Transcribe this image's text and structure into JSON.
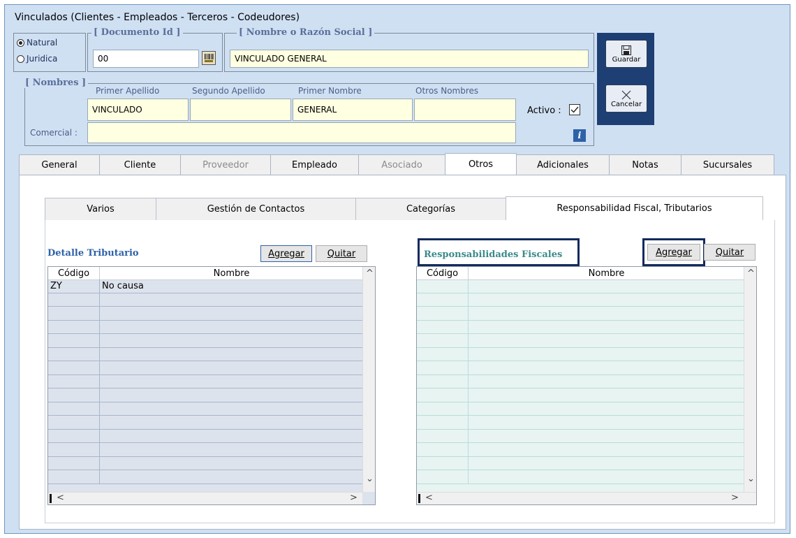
{
  "window": {
    "title": "Vinculados   (Clientes - Empleados - Terceros - Codeudores)"
  },
  "persona": {
    "options": [
      "Natural",
      "Juridica"
    ],
    "selected": "Natural"
  },
  "documento": {
    "legend": "[ Documento Id ]",
    "value": "00"
  },
  "razon_social": {
    "legend": "[ Nombre o Razón Social ]",
    "value": "VINCULADO GENERAL"
  },
  "nombres": {
    "legend": "[ Nombres ]",
    "primer_apellido": {
      "label": "Primer Apellido",
      "value": "VINCULADO"
    },
    "segundo_apellido": {
      "label": "Segundo Apellido",
      "value": ""
    },
    "primer_nombre": {
      "label": "Primer Nombre",
      "value": "GENERAL"
    },
    "otros_nombres": {
      "label": "Otros Nombres",
      "value": ""
    },
    "activo_label": "Activo :",
    "activo_checked": true,
    "comercial_label": "Comercial :",
    "comercial_value": "",
    "info_glyph": "i"
  },
  "actions": {
    "guardar": "Guardar",
    "cancelar": "Cancelar"
  },
  "tabs": [
    {
      "label": "General",
      "state": "normal"
    },
    {
      "label": "Cliente",
      "state": "normal"
    },
    {
      "label": "Proveedor",
      "state": "disabled"
    },
    {
      "label": "Empleado",
      "state": "normal"
    },
    {
      "label": "Asociado",
      "state": "disabled"
    },
    {
      "label": "Otros",
      "state": "active"
    },
    {
      "label": "Adicionales",
      "state": "normal"
    },
    {
      "label": "Notas",
      "state": "normal"
    },
    {
      "label": "Sucursales",
      "state": "normal"
    }
  ],
  "subtabs": [
    {
      "label": "Varios",
      "active": false
    },
    {
      "label": "Gestión de Contactos",
      "active": false
    },
    {
      "label": "Categorías",
      "active": false
    },
    {
      "label": "Responsabilidad Fiscal, Tributarios",
      "active": true
    }
  ],
  "detalle": {
    "title": "Detalle Tributario",
    "agregar": "Agregar",
    "quitar": "Quitar",
    "columns": [
      "Código",
      "Nombre"
    ],
    "rows": [
      {
        "codigo": "ZY",
        "nombre": "No causa"
      }
    ]
  },
  "responsabilidades": {
    "title": "Responsabilidades Fiscales",
    "agregar": "Agregar",
    "quitar": "Quitar",
    "columns": [
      "Código",
      "Nombre"
    ],
    "rows": []
  },
  "colors": {
    "accent_blue": "#2e62a8",
    "teal": "#3a8a8a",
    "field_yellow": "#ffffe1",
    "dark_navy": "#132a5c"
  }
}
